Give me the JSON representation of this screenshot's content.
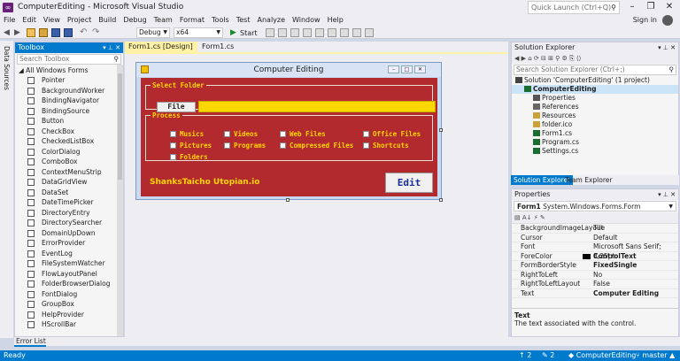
{
  "window": {
    "title": "ComputerEditing - Microsoft Visual Studio",
    "quick_launch": "Quick Launch (Ctrl+Q)",
    "minimize": "–",
    "maximize": "❐",
    "close": "✕"
  },
  "menu": [
    "File",
    "Edit",
    "View",
    "Project",
    "Build",
    "Debug",
    "Team",
    "Format",
    "Tools",
    "Test",
    "Analyze",
    "Window",
    "Help"
  ],
  "account": {
    "sign_in": "Sign in"
  },
  "toolbar": {
    "config": "Debug",
    "platform": "x64",
    "start": "Start"
  },
  "side_strip": {
    "label": "Data Sources"
  },
  "toolbox": {
    "title": "Toolbox",
    "search_placeholder": "Search Toolbox",
    "category": "All Windows Forms",
    "items": [
      "Pointer",
      "BackgroundWorker",
      "BindingNavigator",
      "BindingSource",
      "Button",
      "CheckBox",
      "CheckedListBox",
      "ColorDialog",
      "ComboBox",
      "ContextMenuStrip",
      "DataGridView",
      "DataSet",
      "DateTimePicker",
      "DirectoryEntry",
      "DirectorySearcher",
      "DomainUpDown",
      "ErrorProvider",
      "EventLog",
      "FileSystemWatcher",
      "FlowLayoutPanel",
      "FolderBrowserDialog",
      "FontDialog",
      "GroupBox",
      "HelpProvider",
      "HScrollBar"
    ]
  },
  "tabs": [
    {
      "label": "Form1.cs [Design]"
    },
    {
      "label": "Form1.cs"
    }
  ],
  "form": {
    "title": "Computer Editing",
    "select_folder": {
      "legend": "Select Folder",
      "file_button": "File"
    },
    "process": {
      "legend": "Process",
      "options": [
        "Musics",
        "Videos",
        "Web Files",
        "Office Files",
        "Pictures",
        "Programs",
        "Compressed Files",
        "Shortcuts",
        "Folders"
      ]
    },
    "brand": "ShanksTaicho Utopian.io",
    "edit_button": "Edit"
  },
  "solution_explorer": {
    "title": "Solution Explorer",
    "search_placeholder": "Search Solution Explorer (Ctrl+;)",
    "tree": [
      {
        "label": "Solution 'ComputerEditing' (1 project)",
        "level": 0
      },
      {
        "label": "ComputerEditing",
        "level": 1,
        "bold": true
      },
      {
        "label": "Properties",
        "level": 2
      },
      {
        "label": "References",
        "level": 2
      },
      {
        "label": "Resources",
        "level": 2
      },
      {
        "label": "folder.ico",
        "level": 2
      },
      {
        "label": "Form1.cs",
        "level": 2
      },
      {
        "label": "Program.cs",
        "level": 2
      },
      {
        "label": "Settings.cs",
        "level": 2
      }
    ],
    "tabs": [
      "Solution Explorer",
      "Team Explorer"
    ]
  },
  "properties": {
    "title": "Properties",
    "object": "Form1",
    "object_type": "System.Windows.Forms.Form",
    "rows": [
      {
        "name": "BackgroundImageLayout",
        "value": "Tile"
      },
      {
        "name": "Cursor",
        "value": "Default"
      },
      {
        "name": "Font",
        "value": "Microsoft Sans Serif; 8,25pt"
      },
      {
        "name": "ForeColor",
        "value": "ControlText"
      },
      {
        "name": "FormBorderStyle",
        "value": "FixedSingle"
      },
      {
        "name": "RightToLeft",
        "value": "No"
      },
      {
        "name": "RightToLeftLayout",
        "value": "False"
      },
      {
        "name": "Text",
        "value": "Computer Editing"
      }
    ],
    "desc_title": "Text",
    "desc_text": "The text associated with the control."
  },
  "error_list": "Error List",
  "status": {
    "ready": "Ready",
    "up": "2",
    "changes": "2",
    "project": "ComputerEditing",
    "branch": "master"
  }
}
